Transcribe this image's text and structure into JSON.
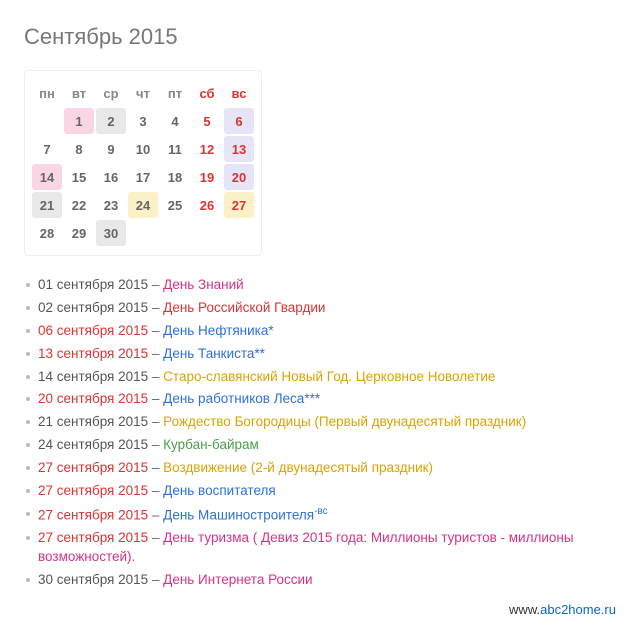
{
  "title": "Сентябрь 2015",
  "weekdays": [
    "пн",
    "вт",
    "ср",
    "чт",
    "пт",
    "сб",
    "вс"
  ],
  "grid": [
    [
      {
        "n": ""
      },
      {
        "n": "1",
        "cls": "d pink"
      },
      {
        "n": "2",
        "cls": "d grey"
      },
      {
        "n": "3",
        "cls": "d"
      },
      {
        "n": "4",
        "cls": "d"
      },
      {
        "n": "5",
        "cls": "sat"
      },
      {
        "n": "6",
        "cls": "sun"
      }
    ],
    [
      {
        "n": "7",
        "cls": "d"
      },
      {
        "n": "8",
        "cls": "d"
      },
      {
        "n": "9",
        "cls": "d"
      },
      {
        "n": "10",
        "cls": "d"
      },
      {
        "n": "11",
        "cls": "d"
      },
      {
        "n": "12",
        "cls": "sat"
      },
      {
        "n": "13",
        "cls": "sun"
      }
    ],
    [
      {
        "n": "14",
        "cls": "d pink"
      },
      {
        "n": "15",
        "cls": "d"
      },
      {
        "n": "16",
        "cls": "d"
      },
      {
        "n": "17",
        "cls": "d"
      },
      {
        "n": "18",
        "cls": "d"
      },
      {
        "n": "19",
        "cls": "sat"
      },
      {
        "n": "20",
        "cls": "sun"
      }
    ],
    [
      {
        "n": "21",
        "cls": "d grey"
      },
      {
        "n": "22",
        "cls": "d"
      },
      {
        "n": "23",
        "cls": "d"
      },
      {
        "n": "24",
        "cls": "d yel"
      },
      {
        "n": "25",
        "cls": "d"
      },
      {
        "n": "26",
        "cls": "sat"
      },
      {
        "n": "27",
        "cls": "sun yel"
      }
    ],
    [
      {
        "n": "28",
        "cls": "d"
      },
      {
        "n": "29",
        "cls": "d"
      },
      {
        "n": "30",
        "cls": "d grey"
      },
      {
        "n": ""
      },
      {
        "n": ""
      },
      {
        "n": ""
      },
      {
        "n": ""
      }
    ]
  ],
  "events": [
    {
      "date": "01 сентября 2015",
      "dc": "date-b",
      "title": "День Знаний",
      "tc": "t-mag"
    },
    {
      "date": "02 сентября 2015",
      "dc": "date-b",
      "title": "День Российской Гвардии",
      "tc": "t-red"
    },
    {
      "date": "06 сентября 2015",
      "dc": "date-r",
      "title": "День Нефтяника*",
      "tc": "t-blue"
    },
    {
      "date": "13 сентября 2015",
      "dc": "date-r",
      "title": "День Танкиста**",
      "tc": "t-blue"
    },
    {
      "date": "14 сентября 2015",
      "dc": "date-b",
      "title": "Старо-славянский Новый Год. Церковное Новолетие",
      "tc": "t-ora"
    },
    {
      "date": "20 сентября 2015",
      "dc": "date-r",
      "title": "День работников Леса***",
      "tc": "t-blue"
    },
    {
      "date": "21 сентября 2015",
      "dc": "date-b",
      "title": "Рождество Богородицы (Первый двунадесятый праздник)",
      "tc": "t-ora"
    },
    {
      "date": "24 сентября 2015",
      "dc": "date-b",
      "title": "Курбан-байрам",
      "tc": "t-grn"
    },
    {
      "date": "27 сентября 2015",
      "dc": "date-r",
      "title": "Воздвижение (2-й двунадесятый праздник)",
      "tc": "t-ora"
    },
    {
      "date": "27 сентября 2015",
      "dc": "date-r",
      "title": "День воспитателя",
      "tc": "t-blue"
    },
    {
      "date": "27 сентября 2015",
      "dc": "date-r",
      "title": "День Машиностроителя",
      "tc": "t-blue",
      "sup": "-вс"
    },
    {
      "date": "27 сентября 2015",
      "dc": "date-r",
      "title": "День туризма ( Девиз 2015 года: Миллионы туристов - миллионы возможностей).",
      "tc": "t-mag"
    },
    {
      "date": "30 сентября 2015",
      "dc": "date-b",
      "title": "День Интернета России",
      "tc": "t-mag"
    }
  ],
  "footer": {
    "prefix": "www.",
    "domain": "abc2home.ru"
  },
  "sep": " – "
}
